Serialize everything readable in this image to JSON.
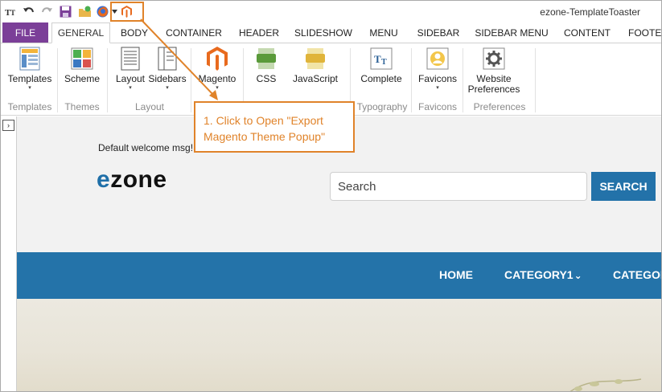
{
  "window": {
    "title": "ezone-TemplateToaster"
  },
  "quick_access": {
    "icons": [
      "typography-icon",
      "undo-icon",
      "redo-icon",
      "save-icon",
      "open-folder-icon",
      "firefox-icon",
      "dropdown-arrow-icon",
      "magento-icon"
    ]
  },
  "tabs": {
    "file": "FILE",
    "items": [
      "GENERAL",
      "BODY",
      "CONTAINER",
      "HEADER",
      "SLIDESHOW",
      "MENU",
      "SIDEBAR",
      "SIDEBAR MENU",
      "CONTENT",
      "FOOTER"
    ],
    "active": "GENERAL"
  },
  "ribbon": {
    "buttons": {
      "templates": "Templates",
      "scheme": "Scheme",
      "layout": "Layout",
      "sidebars": "Sidebars",
      "magento": "Magento",
      "css": "CSS",
      "javascript": "JavaScript",
      "complete": "Complete",
      "favicons": "Favicons",
      "website_preferences_1": "Website",
      "website_preferences_2": "Preferences"
    },
    "groups": {
      "templates": "Templates",
      "themes": "Themes",
      "layout": "Layout",
      "typography": "Typography",
      "favicons": "Favicons",
      "preferences": "Preferences"
    },
    "caret": "▾",
    "css_badge": "CSS",
    "js_badge": "Js",
    "tt_glyph": "TT"
  },
  "preview": {
    "welcome": "Default welcome msg!",
    "logo_e": "e",
    "logo_rest": "zone",
    "search_placeholder": "Search",
    "search_button": "SEARCH",
    "nav": [
      "HOME",
      "CATEGORY1",
      "CATEGOR"
    ],
    "nav_chevron": "⌄"
  },
  "callout": {
    "line1": "1. Click to Open \"Export",
    "line2": "Magento Theme Popup\""
  },
  "side_toggle": "›",
  "colors": {
    "accent_orange": "#e0832a",
    "file_tab": "#7b3f98",
    "nav_blue": "#2473a9",
    "search_blue": "#2372a9"
  }
}
